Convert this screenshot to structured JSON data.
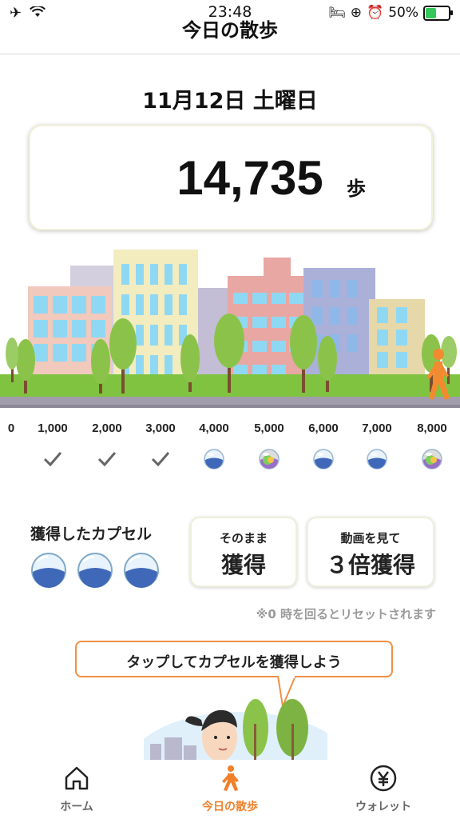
{
  "status_bar": {
    "time": "23:48",
    "left_icons": "✈",
    "battery_percent": "50%",
    "battery_level": 0.5,
    "right_icons": [
      "bed-icon",
      "rotation-lock-icon",
      "alarm-icon"
    ]
  },
  "header": {
    "title": "今日の散歩"
  },
  "date": "11月12日 土曜日",
  "steps": {
    "value": "14,735",
    "unit": "歩"
  },
  "milestones": [
    {
      "label": "0",
      "state": "none"
    },
    {
      "label": "1,000",
      "state": "checked"
    },
    {
      "label": "2,000",
      "state": "checked"
    },
    {
      "label": "3,000",
      "state": "checked"
    },
    {
      "label": "4,000",
      "state": "blue-capsule"
    },
    {
      "label": "5,000",
      "state": "rainbow-capsule"
    },
    {
      "label": "6,000",
      "state": "blue-capsule"
    },
    {
      "label": "7,000",
      "state": "blue-capsule"
    },
    {
      "label": "8,000",
      "state": "rainbow-capsule"
    }
  ],
  "capsules": {
    "title": "獲得したカプセル",
    "count": 3
  },
  "buttons": {
    "get_small": "そのまま",
    "get_big": "獲得",
    "triple_small": "動画を見て",
    "triple_big": "３倍獲得"
  },
  "reset_note": "※0 時を回るとリセットされます",
  "bubble": "タップしてカプセルを獲得しよう",
  "tabs": [
    {
      "label": "ホーム",
      "icon": "home-icon",
      "active": false
    },
    {
      "label": "今日の散歩",
      "icon": "walking-icon",
      "active": true
    },
    {
      "label": "ウォレット",
      "icon": "yen-icon",
      "active": false
    }
  ],
  "colors": {
    "accent": "#f0802a",
    "inactive": "#666666",
    "sky": "#ffffff",
    "grass": "#7fc341"
  }
}
